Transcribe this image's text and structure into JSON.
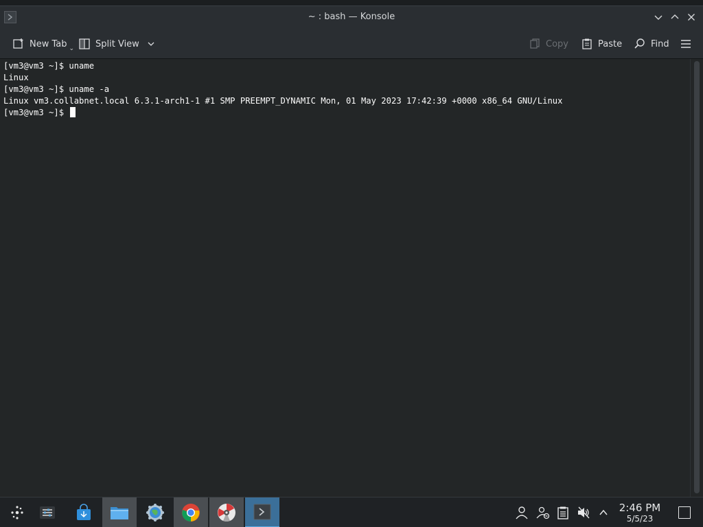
{
  "window": {
    "title": "~ : bash — Konsole",
    "app_icon": "konsole-icon",
    "controls": [
      "minimize-icon",
      "maximize-icon",
      "close-icon"
    ]
  },
  "toolbar": {
    "new_tab": "New Tab",
    "split_view": "Split View",
    "copy": "Copy",
    "paste": "Paste",
    "find": "Find",
    "menu_icon": "hamburger-menu-icon"
  },
  "terminal": {
    "lines": [
      "[vm3@vm3 ~]$ uname",
      "Linux",
      "[vm3@vm3 ~]$ uname -a",
      "Linux vm3.collabnet.local 6.3.1-arch1-1 #1 SMP PREEMPT_DYNAMIC Mon, 01 May 2023 17:42:39 +0000 x86_64 GNU/Linux",
      "[vm3@vm3 ~]$ "
    ]
  },
  "taskbar": {
    "apps": [
      {
        "name": "application-launcher",
        "icon": "steam-deck-launcher-icon"
      },
      {
        "name": "system-settings-panel",
        "icon": "sliders-icon"
      },
      {
        "name": "discover",
        "icon": "store-bag-icon"
      },
      {
        "name": "dolphin",
        "icon": "folder-icon"
      },
      {
        "name": "steam-settings",
        "icon": "gear-globe-icon"
      },
      {
        "name": "chrome",
        "icon": "chrome-icon"
      },
      {
        "name": "disk-app",
        "icon": "disc-icon"
      },
      {
        "name": "konsole",
        "icon": "terminal-icon"
      }
    ],
    "tray": [
      "user-icon",
      "user-switch-icon",
      "clipboard-icon",
      "volume-muted-icon",
      "chevron-up-icon"
    ],
    "clock": {
      "time": "2:46 PM",
      "date": "5/5/23"
    }
  },
  "colors": {
    "terminal_bg": "#232627",
    "chrome_bg": "#2a2e32",
    "accent": "#3b6f99"
  }
}
